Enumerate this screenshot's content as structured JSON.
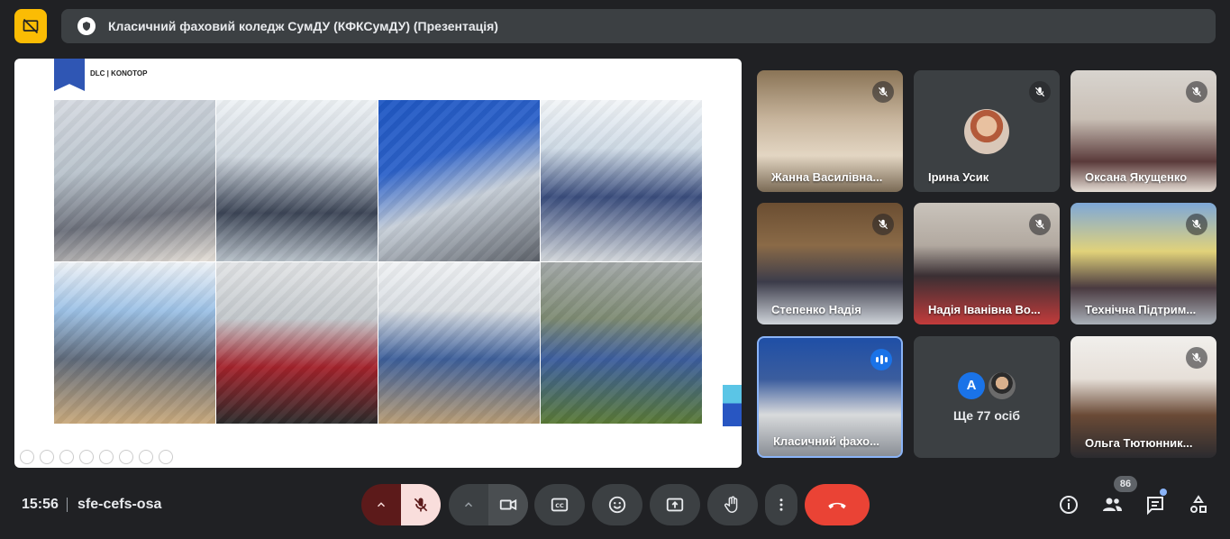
{
  "header": {
    "title": "Класичний фаховий коледж СумДУ (КФКСумДУ) (Презентація)",
    "presenter_badge_icon": "present-off-icon",
    "org_icon": "shield-icon"
  },
  "slide": {
    "brand": "DLC | KONOTOP",
    "accent_color": "#2f56b4"
  },
  "participants": [
    {
      "name": "Жанна Василівна...",
      "muted": true
    },
    {
      "name": "Ірина Усик",
      "muted": true
    },
    {
      "name": "Оксана Якущенко",
      "muted": true
    },
    {
      "name": "Степенко Надія",
      "muted": true
    },
    {
      "name": "Надія Іванівна Во...",
      "muted": true
    },
    {
      "name": "Технічна Підтрим...",
      "muted": true
    },
    {
      "name": "Класичний фахо...",
      "muted": false,
      "speaking": true
    },
    {
      "name": "Ольга Тютюнник...",
      "muted": true
    }
  ],
  "more": {
    "label": "Ще 77 осіб",
    "avatar_letter": "A"
  },
  "footer": {
    "time": "15:56",
    "meeting_code": "sfe-cefs-osa",
    "people_count": "86"
  },
  "colors": {
    "background": "#202124",
    "tile": "#3c4043",
    "hangup": "#ea4335",
    "presenter": "#fbbc04",
    "speaking": "#8ab4f8"
  }
}
